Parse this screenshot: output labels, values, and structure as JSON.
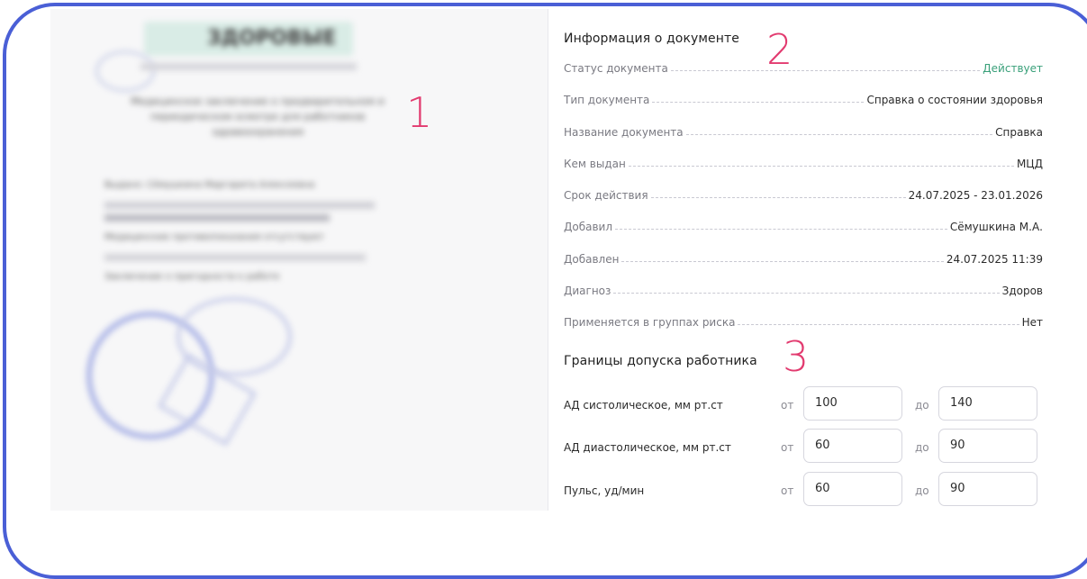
{
  "callouts": {
    "one": "1",
    "two": "2",
    "three": "3"
  },
  "preview": {
    "header_text": "ЗДОРОВЫЕ",
    "title_lines": [
      "Медицинское заключение о предварительном и",
      "периодическом осмотре для работников",
      "здравоохранения"
    ],
    "body_lines": [
      "Выдано: Сёмушкина Маргарита Алексеевна",
      "Срок действия до",
      "Медицинские противопоказания отсутствуют",
      "Заключение о пригодности к работе"
    ]
  },
  "doc_info": {
    "title": "Информация о документе",
    "rows": [
      {
        "label": "Статус документа",
        "value": "Действует"
      },
      {
        "label": "Тип документа",
        "value": "Справка о состоянии здоровья"
      },
      {
        "label": "Название документа",
        "value": "Справка"
      },
      {
        "label": "Кем выдан",
        "value": "МЦД"
      },
      {
        "label": "Срок действия",
        "value": "24.07.2025 - 23.01.2026"
      },
      {
        "label": "Добавил",
        "value": "Сёмушкина М.А."
      },
      {
        "label": "Добавлен",
        "value": "24.07.2025 11:39"
      },
      {
        "label": "Диагноз",
        "value": "Здоров"
      },
      {
        "label": "Применяется в группах риска",
        "value": "Нет"
      }
    ]
  },
  "limits": {
    "title": "Границы допуска работника",
    "from_label": "от",
    "to_label": "до",
    "rows": [
      {
        "label": "АД систолическое, мм рт.ст",
        "from": "100",
        "to": "140"
      },
      {
        "label": "АД диастолическое, мм рт.ст",
        "from": "60",
        "to": "90"
      },
      {
        "label": "Пульс, уд/мин",
        "from": "60",
        "to": "90"
      }
    ]
  },
  "colors": {
    "frame": "#4a5fd6",
    "callout": "#e23a6f",
    "status_ok": "#3aa07a"
  }
}
